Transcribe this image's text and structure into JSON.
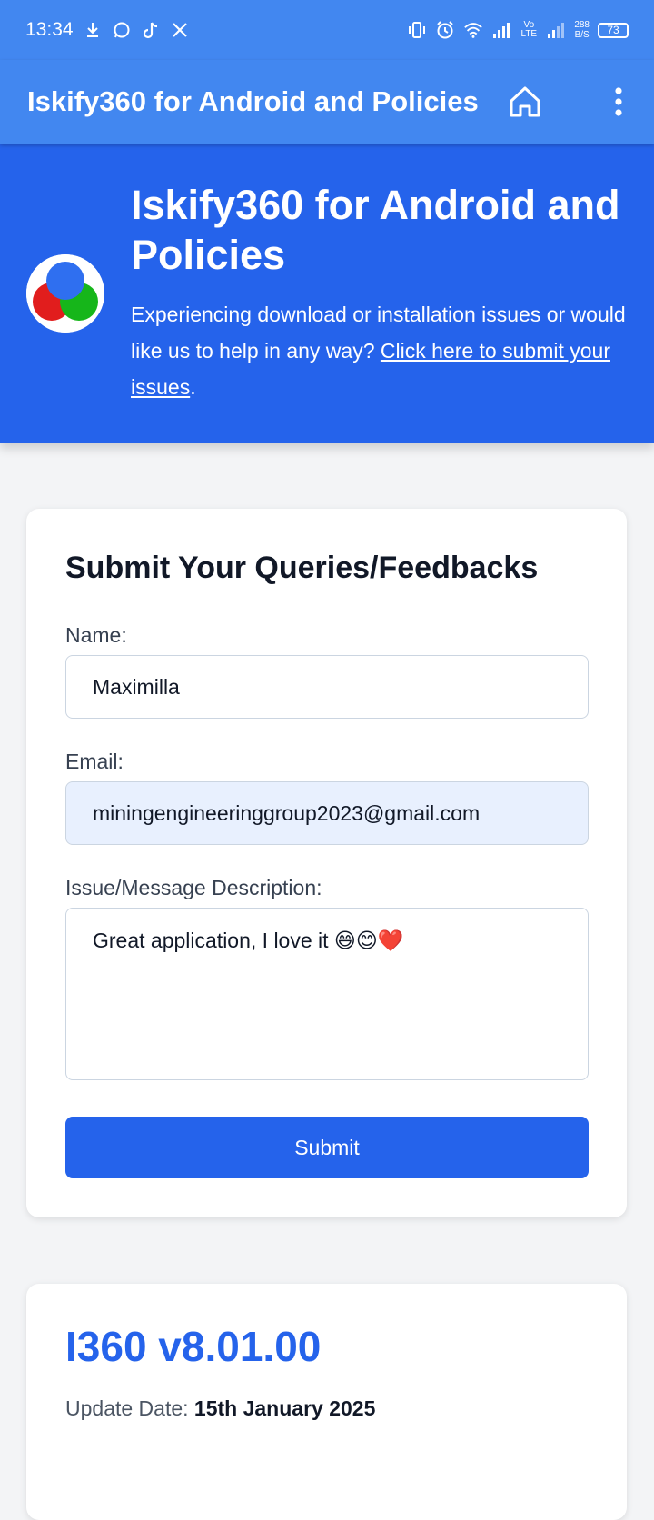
{
  "status_bar": {
    "time": "13:34",
    "net_speed_value": "288",
    "net_speed_unit": "B/S",
    "battery": "73",
    "lte_label": "Vo LTE"
  },
  "appbar": {
    "title": "Iskify360 for Android and Policies"
  },
  "hero": {
    "title": "Iskify360 for Android and Policies",
    "text": "Experiencing download or installation issues or would like us to help in any way? ",
    "link": "Click here to submit your issues",
    "text_end": "."
  },
  "form": {
    "title": "Submit Your Queries/Feedbacks",
    "name_label": "Name:",
    "name_value": "Maximilla",
    "email_label": "Email:",
    "email_value": "miningengineeringgroup2023@gmail.com",
    "message_label": "Issue/Message Description:",
    "message_value": "Great application, I love it 😄😊❤️",
    "submit_label": "Submit"
  },
  "version": {
    "title": "I360 v8.01.00",
    "update_label": "Update Date:",
    "update_date": "15th January 2025"
  },
  "colors": {
    "appbar": "#4287f0",
    "hero": "#2563eb",
    "accent": "#2563eb"
  }
}
